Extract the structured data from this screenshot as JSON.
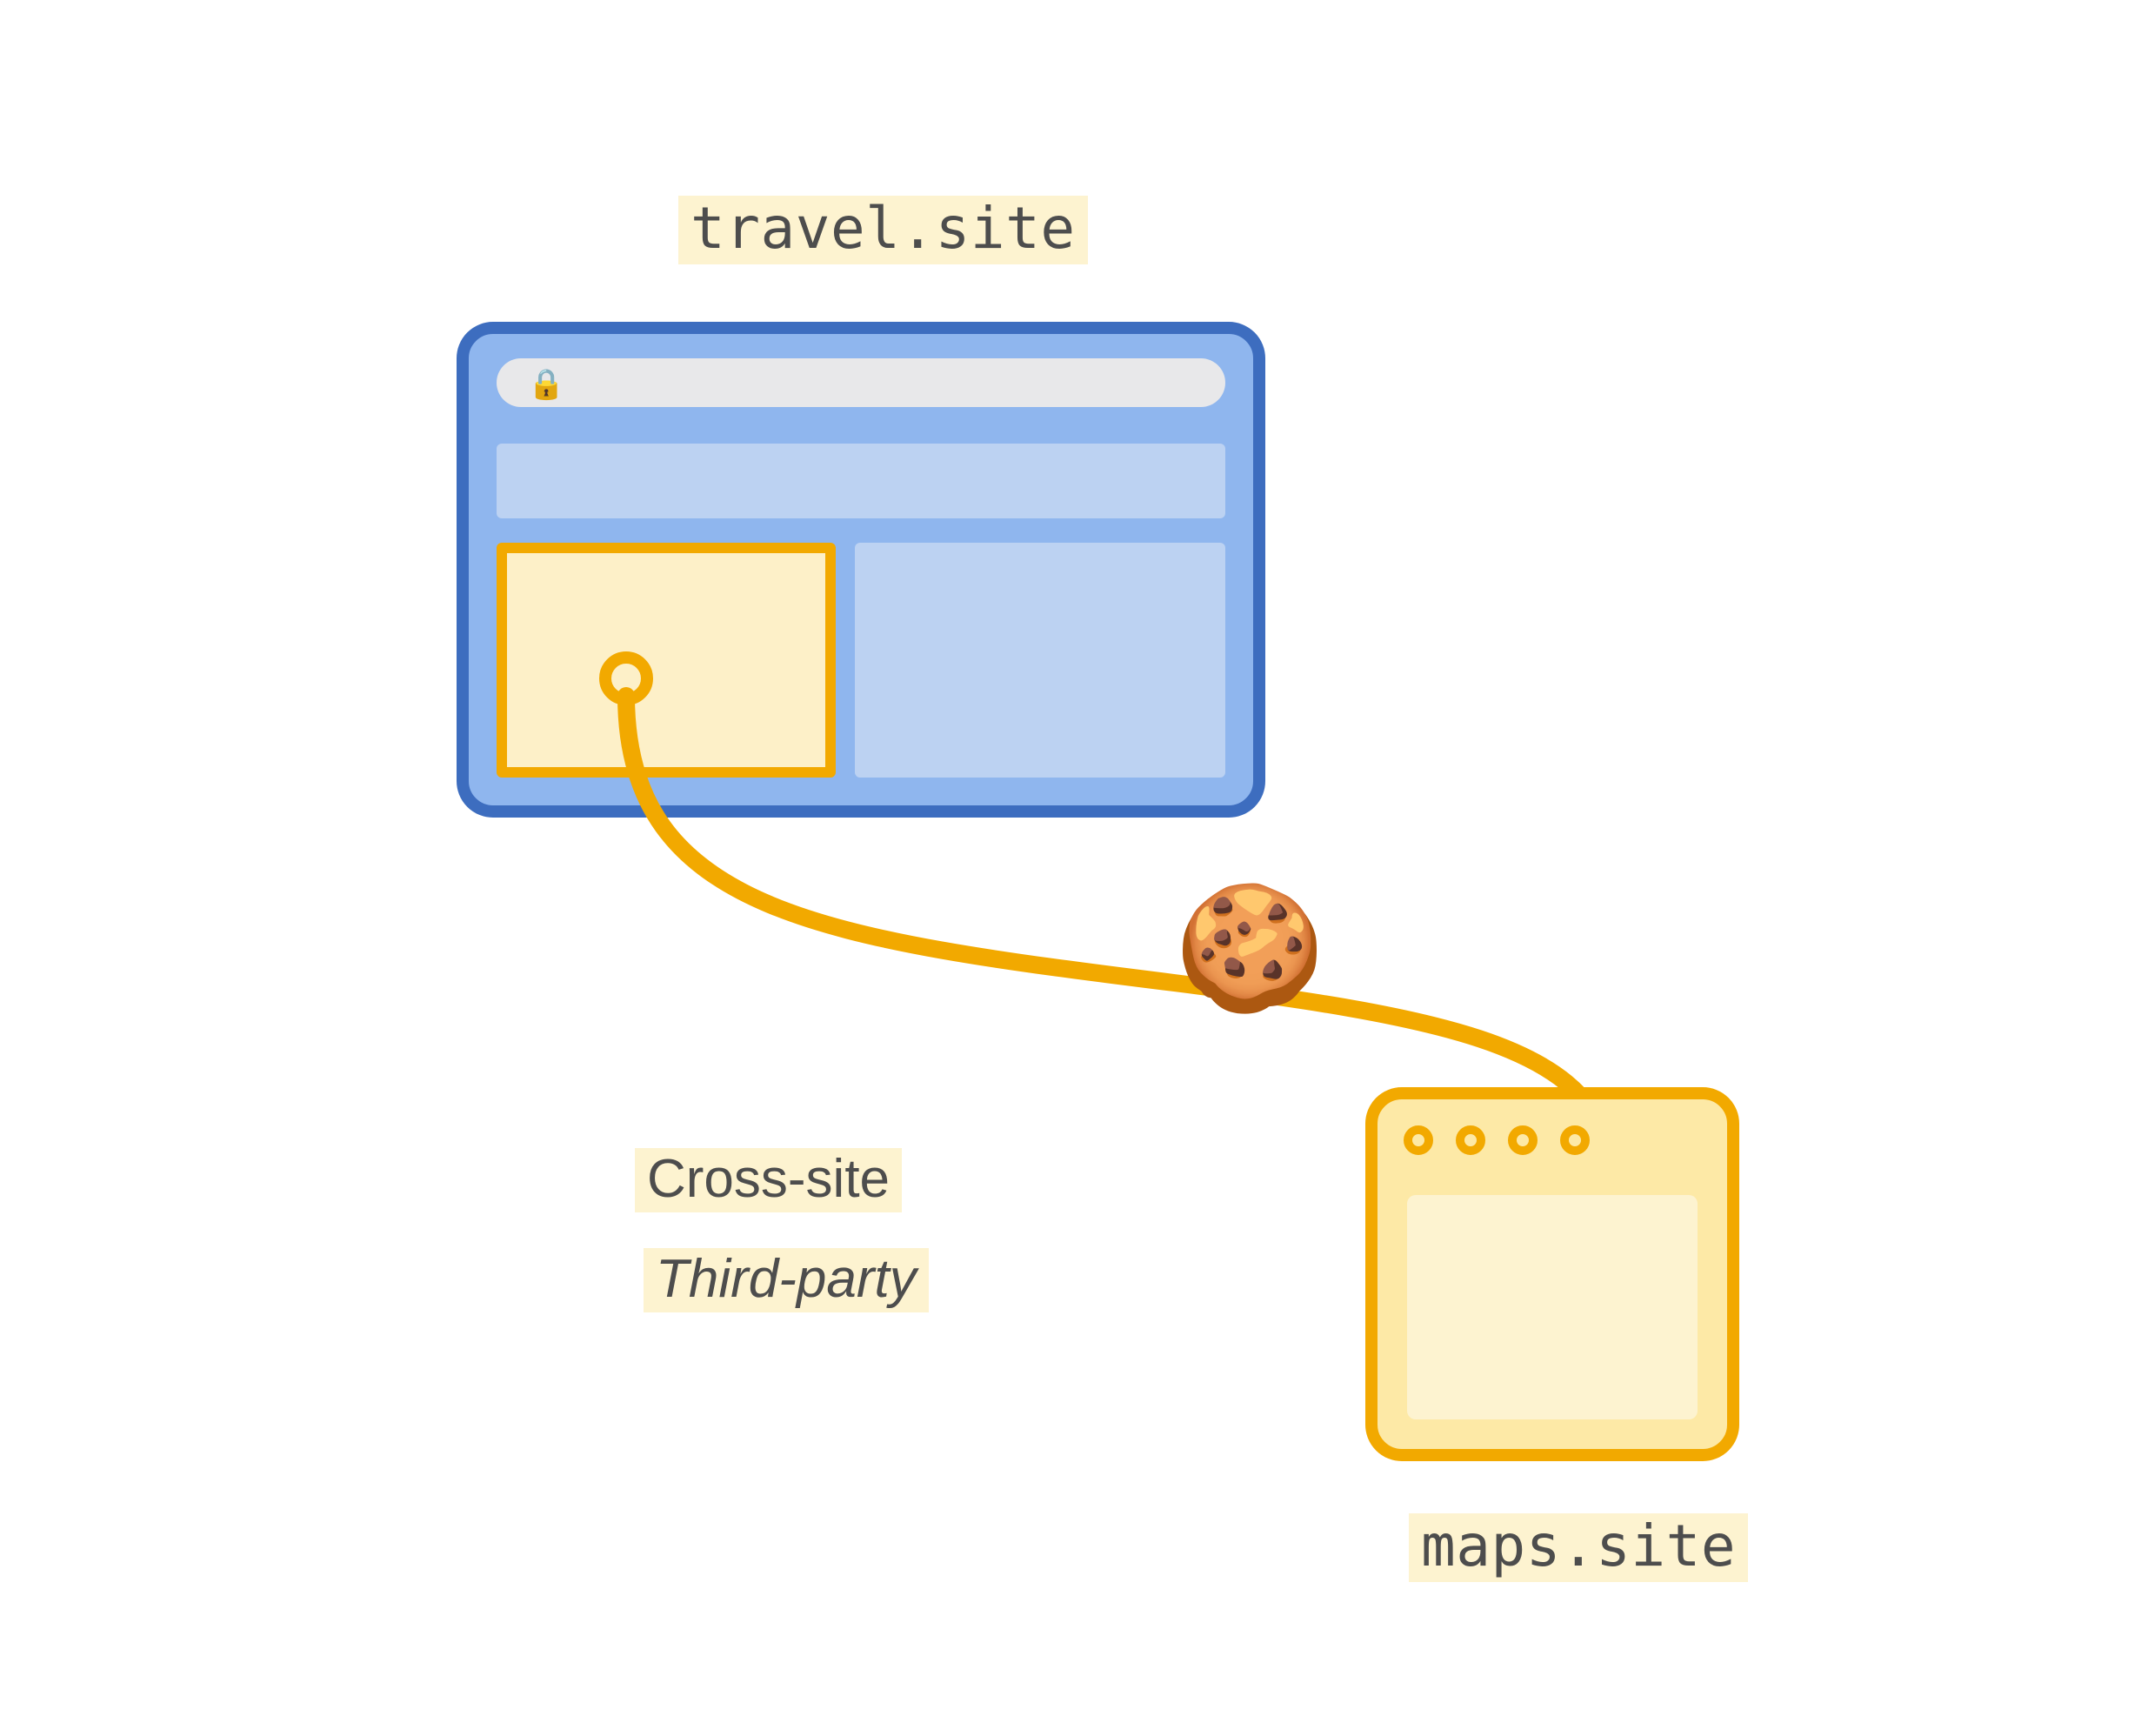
{
  "labels": {
    "origin_site": "travel.site",
    "target_site": "maps.site",
    "cross_site": "Cross-site",
    "third_party": "Third-party"
  },
  "icons": {
    "cookie_glyph": "🍪"
  },
  "colors": {
    "orange": "#f2a900",
    "blue_border": "#3d6dbf",
    "blue_fill": "#8fb6ee",
    "blue_light": "#bcd2f2",
    "highlight_bg": "#fdf3d0",
    "server_fill": "#fde9a6"
  }
}
